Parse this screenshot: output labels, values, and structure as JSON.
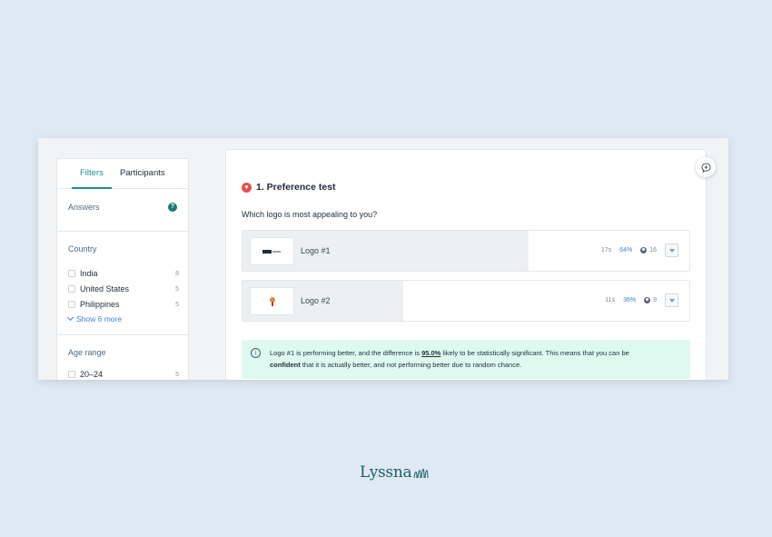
{
  "sidebar": {
    "tabs": [
      {
        "label": "Filters",
        "active": true
      },
      {
        "label": "Participants",
        "active": false
      }
    ],
    "answers": {
      "title": "Answers",
      "help_icon": "?"
    },
    "country": {
      "title": "Country",
      "items": [
        {
          "label": "India",
          "count": "8"
        },
        {
          "label": "United States",
          "count": "5"
        },
        {
          "label": "Philippines",
          "count": "5"
        }
      ],
      "show_more": "Show 6 more"
    },
    "age_range": {
      "title": "Age range",
      "items": [
        {
          "label": "20–24",
          "count": "5"
        }
      ]
    }
  },
  "main": {
    "title": "1. Preference test",
    "question": "Which logo is most appealing to you?",
    "options": [
      {
        "label": "Logo #1",
        "time": "17s",
        "percent": "64%",
        "percent_value": 64,
        "votes": "16"
      },
      {
        "label": "Logo #2",
        "time": "11s",
        "percent": "36%",
        "percent_value": 36,
        "votes": "9"
      }
    ],
    "notice": {
      "part1": "Logo #1 is performing better, and the difference is ",
      "highlight": "95.0%",
      "part2": " likely to be statistically significant. This means that you can be ",
      "bold": "confident",
      "part3": " that it is actually better, and not performing better due to random chance."
    }
  },
  "brand": {
    "name": "Lyssna"
  },
  "colors": {
    "background": "#dfe9f4",
    "accent": "#1f8f8b",
    "link": "#3d7fd6",
    "notice_bg": "#defaf0",
    "heart": "#e3514b"
  }
}
